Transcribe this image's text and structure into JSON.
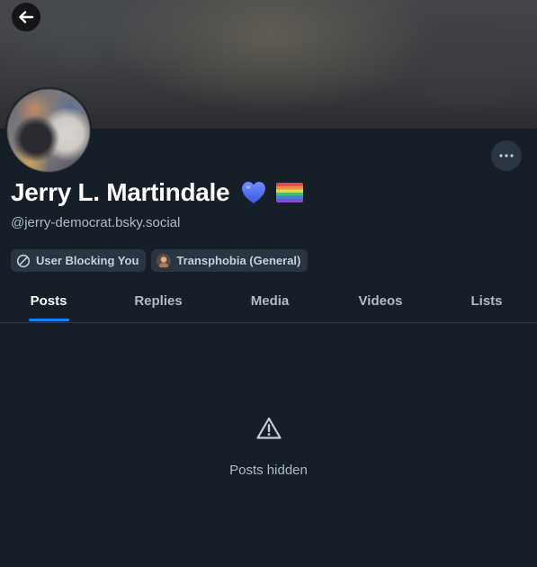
{
  "profile": {
    "display_name": "Jerry L. Martindale",
    "handle": "@jerry-democrat.bsky.social",
    "emoji_icons": [
      "blue-heart-icon",
      "rainbow-flag-icon"
    ]
  },
  "labels": [
    {
      "text": "User Blocking You",
      "icon": "block-icon"
    },
    {
      "text": "Transphobia (General)",
      "icon": "labeler-avatar-icon"
    }
  ],
  "tabs": [
    {
      "label": "Posts",
      "active": true
    },
    {
      "label": "Replies",
      "active": false
    },
    {
      "label": "Media",
      "active": false
    },
    {
      "label": "Videos",
      "active": false
    },
    {
      "label": "Lists",
      "active": false
    }
  ],
  "feed": {
    "status": "Posts hidden",
    "icon": "warning-icon"
  },
  "colors": {
    "background": "#161e27",
    "accent": "#1083fe",
    "pill": "#2a3443",
    "muted_text": "#aebbc9"
  }
}
